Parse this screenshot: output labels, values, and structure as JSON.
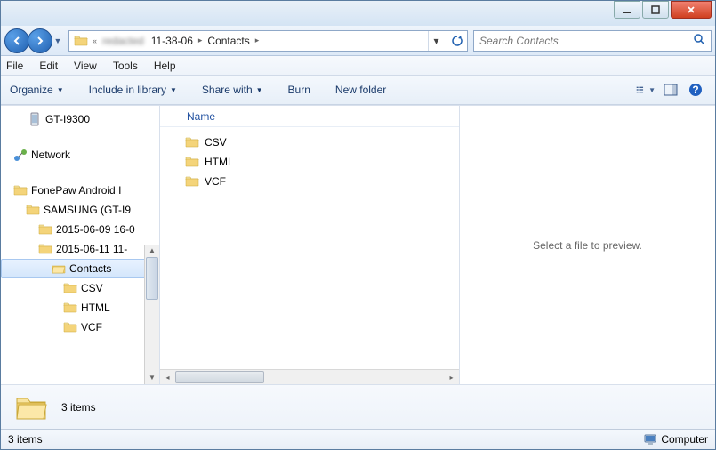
{
  "breadcrumbs": {
    "hidden_segment": "redacted",
    "seg1": "11-38-06",
    "seg2": "Contacts"
  },
  "search": {
    "placeholder": "Search Contacts"
  },
  "menus": {
    "file": "File",
    "edit": "Edit",
    "view": "View",
    "tools": "Tools",
    "help": "Help"
  },
  "toolbar": {
    "organize": "Organize",
    "include": "Include in library",
    "share": "Share with",
    "burn": "Burn",
    "newfolder": "New folder"
  },
  "navtree": {
    "item0": "GT-I9300",
    "network": "Network",
    "fonepaw": "FonePaw Android I",
    "samsung": "SAMSUNG (GT-I9",
    "d1": "2015-06-09 16-0",
    "d2": "2015-06-11 11-",
    "contacts": "Contacts",
    "csv": "CSV",
    "html": "HTML",
    "vcf": "VCF"
  },
  "list": {
    "header_name": "Name",
    "items": [
      "CSV",
      "HTML",
      "VCF"
    ]
  },
  "preview_text": "Select a file to preview.",
  "details": {
    "count_text": "3 items"
  },
  "status": {
    "left": "3 items",
    "computer": "Computer"
  }
}
